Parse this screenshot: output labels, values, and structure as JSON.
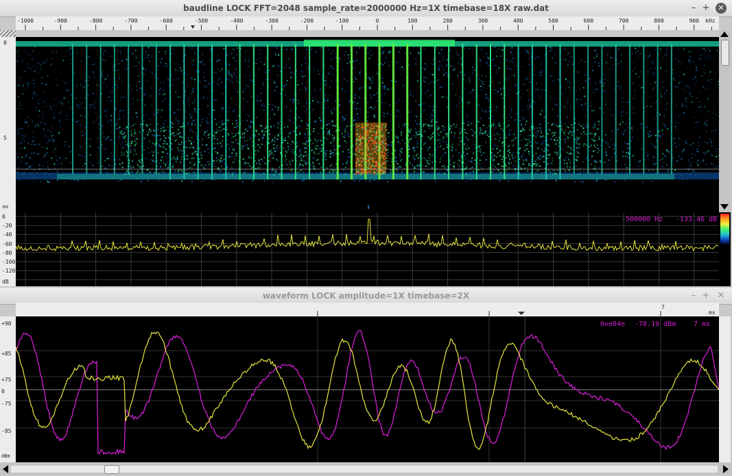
{
  "window1": {
    "title": "baudline  LOCK FFT=2048 sample_rate=2000000 Hz=1X timebase=18X  raw.dat",
    "buttons": {
      "minimize": "–",
      "maximize": "+",
      "close": "✕"
    },
    "freq_unit": "kHz",
    "freq_ticks": [
      "-1000",
      "-900",
      "-800",
      "-700",
      "-600",
      "-500",
      "-400",
      "-300",
      "-200",
      "-100",
      "0",
      "100",
      "200",
      "300",
      "400",
      "500",
      "600",
      "700",
      "800",
      "900"
    ],
    "time_ticks": [
      "0",
      "5"
    ],
    "time_unit": "ms",
    "db_ticks": [
      "0",
      "-20",
      "-40",
      "-60",
      "-80",
      "-100",
      "-120"
    ],
    "db_unit": "dB",
    "readout_freq": "-500000 Hz",
    "readout_db": "-133.46 dB"
  },
  "window2": {
    "title": "waveform  LOCK amplitude=1X timebase=2X",
    "buttons": {
      "minimize": "–",
      "maximize": "+",
      "close": "✕"
    },
    "time_tick": "7",
    "time_unit": "ms",
    "y_ticks": [
      "+90",
      "+85",
      "+75",
      "0",
      "-75",
      "-85",
      "-90"
    ],
    "y_unit": "dBm",
    "readout_hex": "0xe04e",
    "readout_level": "-78.19 dBm",
    "readout_time": "7 ms"
  },
  "colors": {
    "spectrogram_high": "#ff3020",
    "spectrogram_mid": "#20e880",
    "spectrogram_low": "#1050a0",
    "trace_yellow": "#e8e840",
    "trace_magenta": "#e020e0",
    "readout": "#d020d0"
  }
}
